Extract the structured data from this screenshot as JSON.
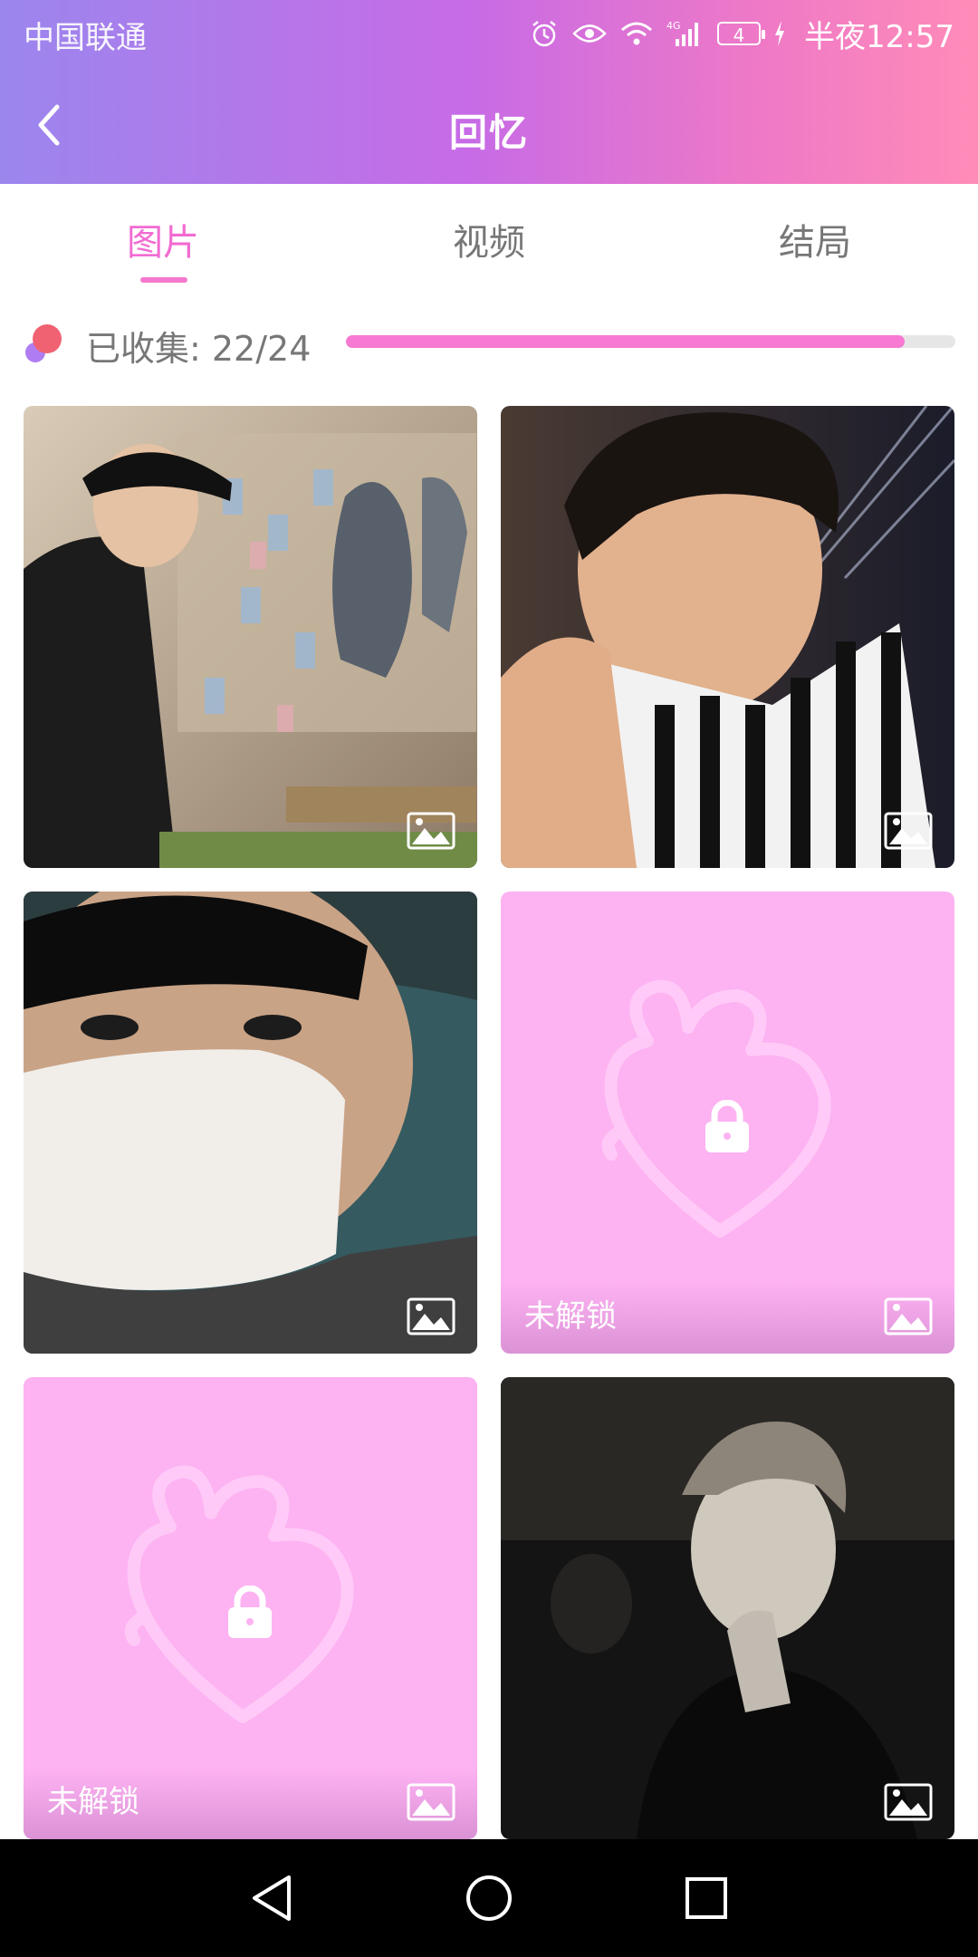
{
  "status_bar": {
    "carrier": "中国联通",
    "network": "4G",
    "battery_level": "4",
    "time": "半夜12:57"
  },
  "header": {
    "title": "回忆",
    "back_icon": "chevron-left-icon"
  },
  "tabs": [
    {
      "label": "图片",
      "active": true
    },
    {
      "label": "视频",
      "active": false
    },
    {
      "label": "结局",
      "active": false
    }
  ],
  "progress": {
    "label": "已收集: 22/24",
    "collected": 22,
    "total": 24,
    "fill_fraction": 0.917
  },
  "gallery": {
    "items": [
      {
        "locked": false,
        "media_type": "image-icon"
      },
      {
        "locked": false,
        "media_type": "image-icon"
      },
      {
        "locked": false,
        "media_type": "image-icon"
      },
      {
        "locked": true,
        "lock_label": "未解锁",
        "media_type": "image-icon"
      },
      {
        "locked": true,
        "lock_label": "未解锁",
        "media_type": "image-icon"
      },
      {
        "locked": false,
        "media_type": "image-icon"
      }
    ]
  },
  "nav": {
    "back": "triangle-back-icon",
    "home": "circle-home-icon",
    "recents": "square-recents-icon"
  },
  "colors": {
    "accent": "#f26bd2",
    "progress_fill": "#f779d2",
    "locked_tile": "#fdb2f2",
    "header_gradient_start": "#9b86ee",
    "header_gradient_end": "#ff8cb8"
  }
}
